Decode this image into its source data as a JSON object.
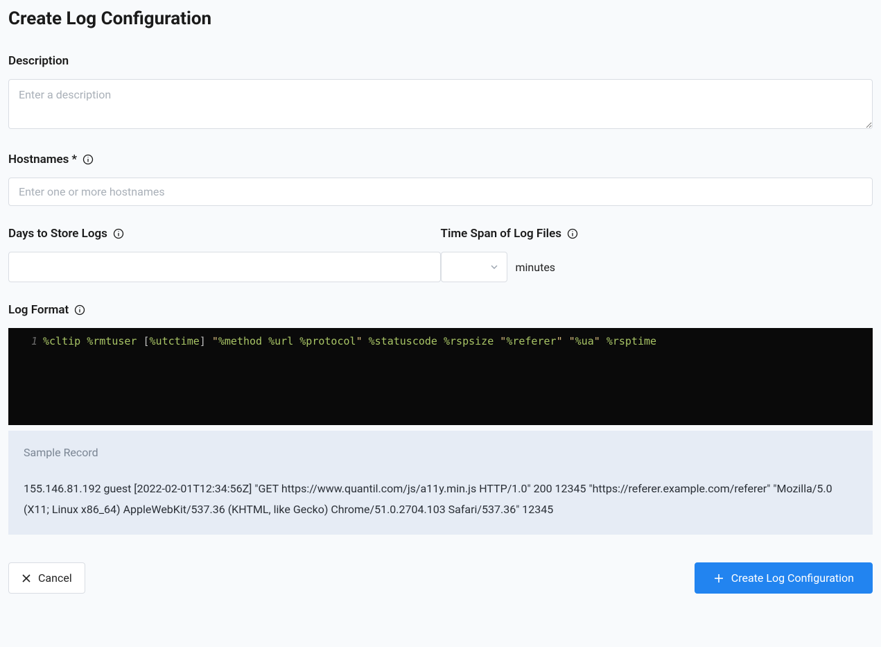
{
  "page": {
    "title": "Create Log Configuration"
  },
  "fields": {
    "description": {
      "label": "Description",
      "placeholder": "Enter a description",
      "value": ""
    },
    "hostnames": {
      "label": "Hostnames",
      "required": "*",
      "placeholder": "Enter one or more hostnames",
      "value": ""
    },
    "days_to_store": {
      "label": "Days to Store Logs",
      "value": ""
    },
    "time_span": {
      "label": "Time Span of Log Files",
      "value": "",
      "unit": "minutes"
    },
    "log_format": {
      "label": "Log Format",
      "line_number": "1",
      "tokens": [
        {
          "t": "var",
          "v": "%cltip"
        },
        {
          "t": "sp",
          "v": " "
        },
        {
          "t": "var",
          "v": "%rmtuser"
        },
        {
          "t": "sp",
          "v": " "
        },
        {
          "t": "brkt",
          "v": "["
        },
        {
          "t": "var",
          "v": "%utctime"
        },
        {
          "t": "brkt",
          "v": "]"
        },
        {
          "t": "sp",
          "v": " "
        },
        {
          "t": "str",
          "v": "\""
        },
        {
          "t": "var",
          "v": "%method"
        },
        {
          "t": "sp",
          "v": " "
        },
        {
          "t": "var",
          "v": "%url"
        },
        {
          "t": "sp",
          "v": " "
        },
        {
          "t": "var",
          "v": "%protocol"
        },
        {
          "t": "str",
          "v": "\""
        },
        {
          "t": "sp",
          "v": " "
        },
        {
          "t": "var",
          "v": "%statuscode"
        },
        {
          "t": "sp",
          "v": " "
        },
        {
          "t": "var",
          "v": "%rspsize"
        },
        {
          "t": "sp",
          "v": " "
        },
        {
          "t": "str",
          "v": "\""
        },
        {
          "t": "var",
          "v": "%referer"
        },
        {
          "t": "str",
          "v": "\""
        },
        {
          "t": "sp",
          "v": " "
        },
        {
          "t": "str",
          "v": "\""
        },
        {
          "t": "var",
          "v": "%ua"
        },
        {
          "t": "str",
          "v": "\""
        },
        {
          "t": "sp",
          "v": " "
        },
        {
          "t": "var",
          "v": "%rsptime"
        }
      ]
    }
  },
  "sample": {
    "title": "Sample Record",
    "text": "155.146.81.192 guest [2022-02-01T12:34:56Z] \"GET https://www.quantil.com/js/a11y.min.js HTTP/1.0\" 200 12345 \"https://referer.example.com/referer\" \"Mozilla/5.0 (X11; Linux x86_64) AppleWebKit/537.36 (KHTML, like Gecko) Chrome/51.0.2704.103 Safari/537.36\" 12345"
  },
  "buttons": {
    "cancel": "Cancel",
    "submit": "Create Log Configuration"
  }
}
